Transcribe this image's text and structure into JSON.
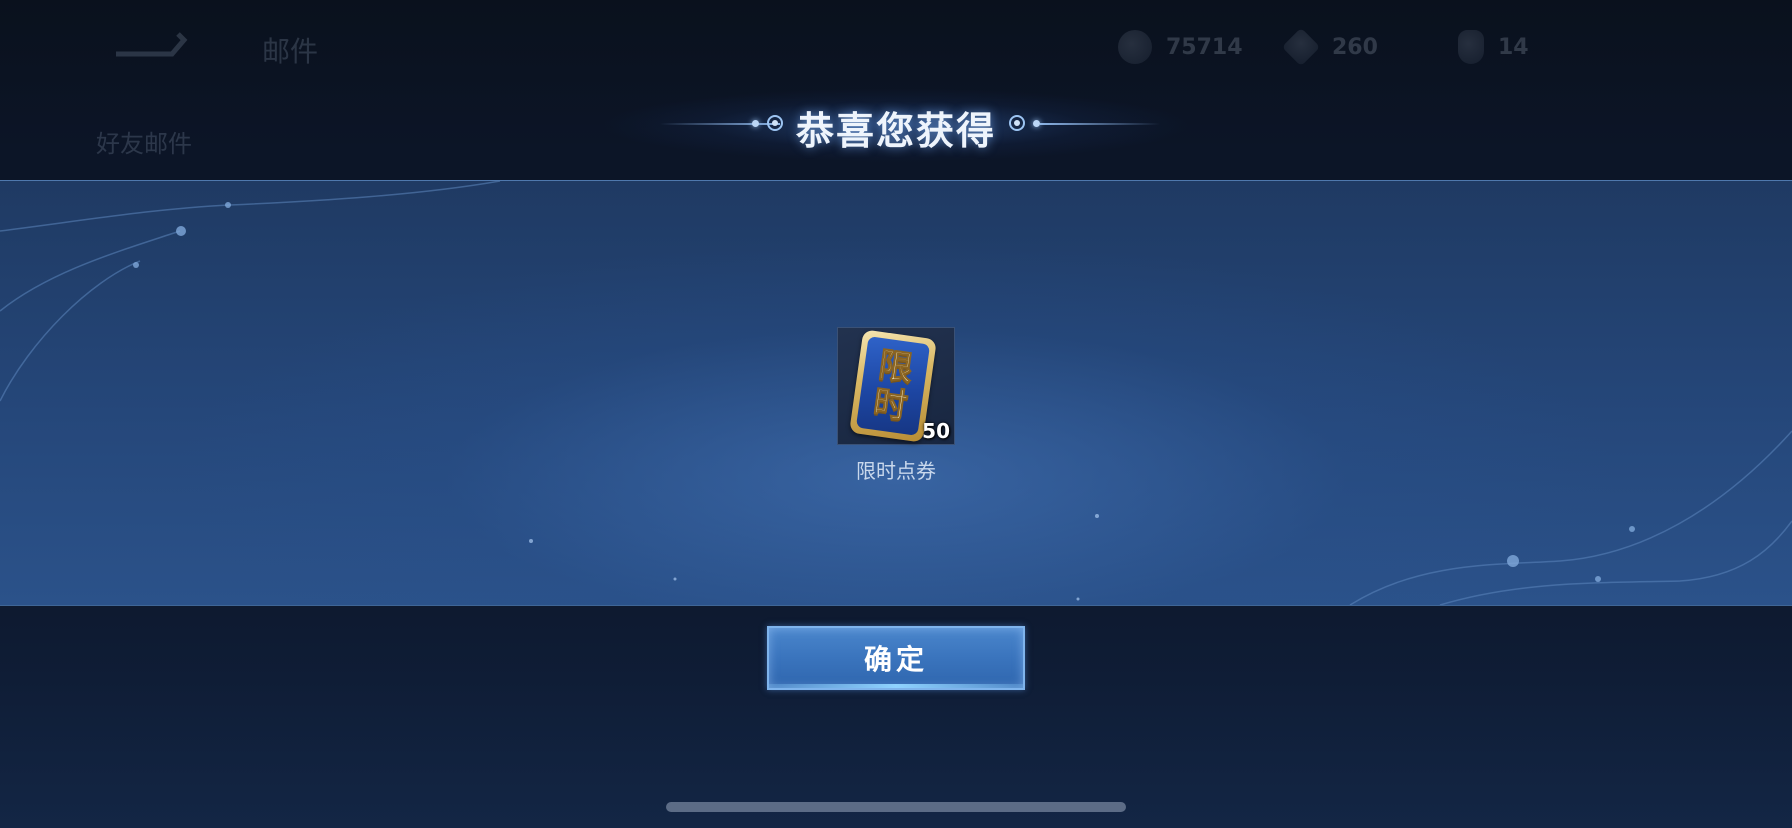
{
  "hud": {
    "page_title": "邮件",
    "sub_label": "好友邮件",
    "resources": [
      {
        "icon": "coin-icon",
        "value": "75714"
      },
      {
        "icon": "diamond-icon",
        "value": "260"
      },
      {
        "icon": "bottle-icon",
        "value": "14"
      }
    ]
  },
  "dialog": {
    "title": "恭喜您获得",
    "reward": {
      "icon": "limited-time-voucher-icon",
      "icon_chars": [
        "限",
        "时"
      ],
      "count": "50",
      "name": "限时点券"
    },
    "confirm_label": "确定"
  },
  "colors": {
    "panel": "#25477a",
    "button": "#3a74bd",
    "title_text": "#eef4fc",
    "voucher_gold": "#d9b865",
    "voucher_blue": "#1d46a3"
  }
}
